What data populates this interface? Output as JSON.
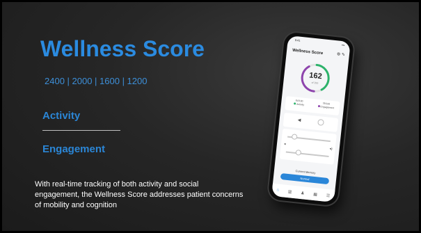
{
  "slide": {
    "title": "Wellness Score",
    "sizes": "2400 | 2000 | 1600 | 1200",
    "activity": "Activity",
    "engagement": "Engagement",
    "body": "With real-time tracking of both activity and social engagement, the Wellness Score addresses patient concerns of mobility and cognition"
  },
  "phone": {
    "time": "9:41",
    "app_title": "Wellness Score",
    "score": "162",
    "score_sub": "of 200",
    "stat_activity_value": "84/100",
    "stat_activity_label": "Activity",
    "stat_engagement_value": "78/100",
    "stat_engagement_label": "Engagement",
    "memory_label": "Current Memory",
    "memory_button": "Normal",
    "score_fraction": 0.81,
    "colors": {
      "accent": "#2a86d8",
      "gauge_green": "#2db36b",
      "gauge_purple": "#8e44ad"
    }
  }
}
